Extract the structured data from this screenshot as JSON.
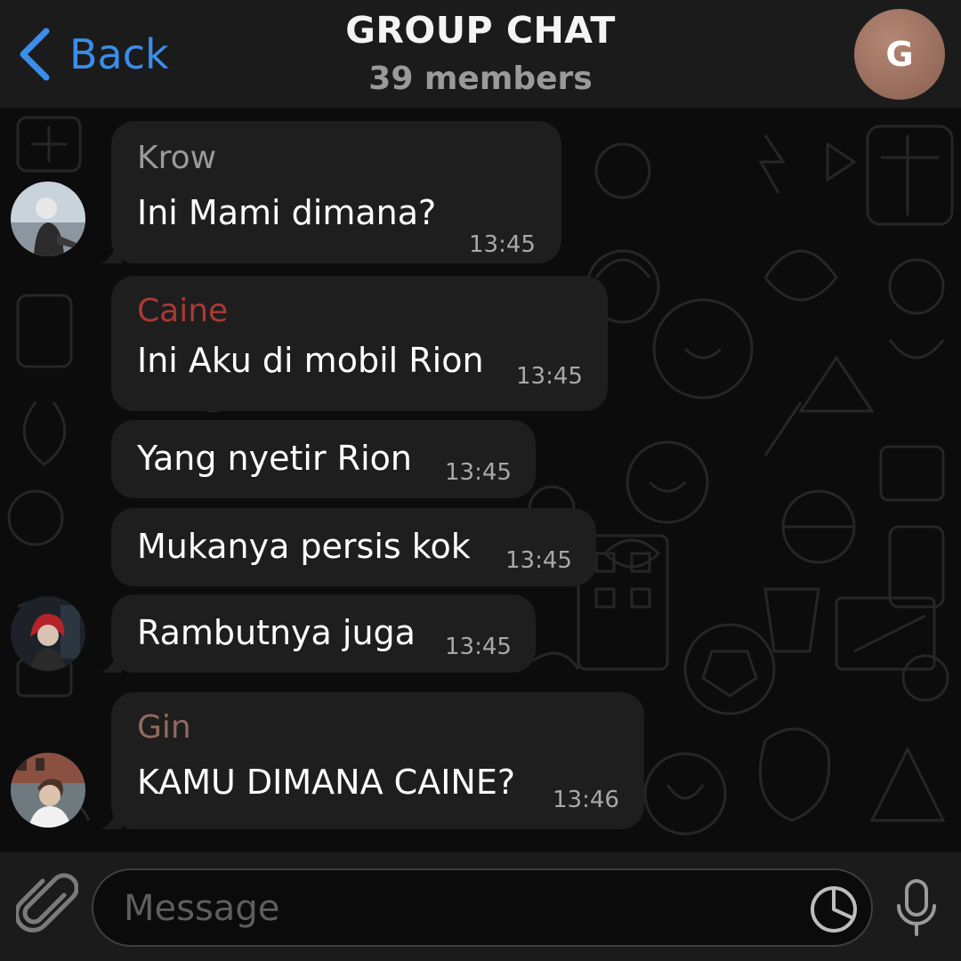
{
  "header": {
    "back_label": "Back",
    "title": "GROUP CHAT",
    "members": "39 members",
    "avatar_initial": "G",
    "back_color": "#3a8eea"
  },
  "messages": [
    {
      "sender": "Krow",
      "sender_color": "#9a9a9a",
      "text": "Ini Mami dimana?",
      "time": "13:45"
    },
    {
      "sender": "Caine",
      "sender_color": "#a93a32",
      "text": "Ini Aku di mobil Rion",
      "time": "13:45"
    },
    {
      "sender": "",
      "text": "Yang nyetir Rion",
      "time": "13:45"
    },
    {
      "sender": "",
      "text": "Mukanya persis kok",
      "time": "13:45"
    },
    {
      "sender": "",
      "text": "Rambutnya juga",
      "time": "13:45"
    },
    {
      "sender": "Gin",
      "sender_color": "#8f6a5d",
      "text": "KAMU DIMANA CAINE?",
      "time": "13:46"
    }
  ],
  "composer": {
    "placeholder": "Message",
    "icons": [
      "paperclip-icon",
      "sticker-icon",
      "microphone-icon"
    ]
  }
}
